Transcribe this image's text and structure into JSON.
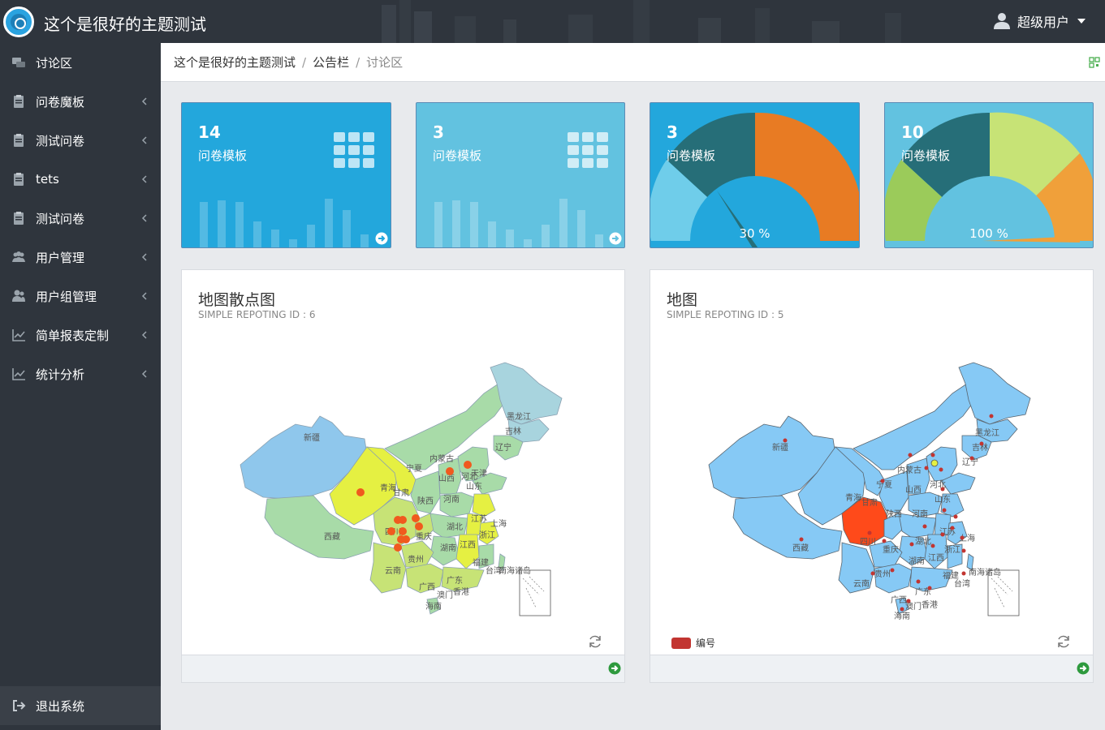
{
  "header": {
    "app_title": "这个是很好的主题测试",
    "user_label": "超级用户",
    "accent": "#2aa3e0"
  },
  "sidebar": {
    "items": [
      {
        "label": "讨论区",
        "icon": "discussion-icon",
        "has_children": false
      },
      {
        "label": "问卷魔板",
        "icon": "clipboard-icon",
        "has_children": true
      },
      {
        "label": "测试问卷",
        "icon": "clipboard-icon",
        "has_children": true
      },
      {
        "label": "tets",
        "icon": "clipboard-icon",
        "has_children": true
      },
      {
        "label": "测试问卷",
        "icon": "clipboard-icon",
        "has_children": true
      },
      {
        "label": "用户管理",
        "icon": "users-icon",
        "has_children": true
      },
      {
        "label": "用户组管理",
        "icon": "user-group-icon",
        "has_children": true
      },
      {
        "label": "简单报表定制",
        "icon": "line-chart-icon",
        "has_children": true
      },
      {
        "label": "统计分析",
        "icon": "line-chart-icon",
        "has_children": true
      }
    ],
    "logout_label": "退出系统"
  },
  "breadcrumb": {
    "items": [
      "这个是很好的主题测试",
      "公告栏",
      "讨论区"
    ],
    "separator": "/"
  },
  "stats": [
    {
      "value": "14",
      "label": "问卷模板",
      "color": "#23a7dc",
      "visual": "bars"
    },
    {
      "value": "3",
      "label": "问卷模板",
      "color": "#62c2e0",
      "visual": "bars"
    },
    {
      "value": "3",
      "label": "问卷模板",
      "color": "#23a7dc",
      "visual": "gauge",
      "percent_text": "30 %",
      "percent": 30
    },
    {
      "value": "10",
      "label": "问卷模板",
      "color": "#62c2e0",
      "visual": "gauge",
      "percent_text": "100 %",
      "percent": 100
    }
  ],
  "panels": [
    {
      "title": "地图散点图",
      "subtitle": "SIMPLE REPOTING ID : 6"
    },
    {
      "title": "地图",
      "subtitle": "SIMPLE REPOTING ID : 5",
      "legend_label": "编号",
      "legend_color": "#c23531"
    }
  ],
  "map_labels": {
    "xinjiang": "新疆",
    "xizang": "西藏",
    "qinghai": "青海",
    "gansu": "甘肃",
    "neimenggu": "内蒙古",
    "heilongjiang": "黑龙江",
    "jilin": "吉林",
    "liaoning": "辽宁",
    "ningxia": "宁夏",
    "shanxi": "山西",
    "hebei": "河北",
    "shandong": "山东",
    "shaanxi": "陕西",
    "henan": "河南",
    "hubei": "湖北",
    "jiangsu": "江苏",
    "sichuan": "四川",
    "chongqing": "重庆",
    "hunan": "湖南",
    "jiangxi": "江西",
    "zhejiang": "浙江",
    "shanghai": "上海",
    "guizhou": "贵州",
    "yunnan": "云南",
    "guangxi": "广西",
    "guangdong": "广东",
    "fujian": "福建",
    "taiwan": "台湾",
    "hainan": "海南",
    "xianggang": "香港",
    "aomen": "澳门",
    "nanhai": "南海诸岛",
    "tianjin": "天津",
    "beijing": "北京"
  }
}
